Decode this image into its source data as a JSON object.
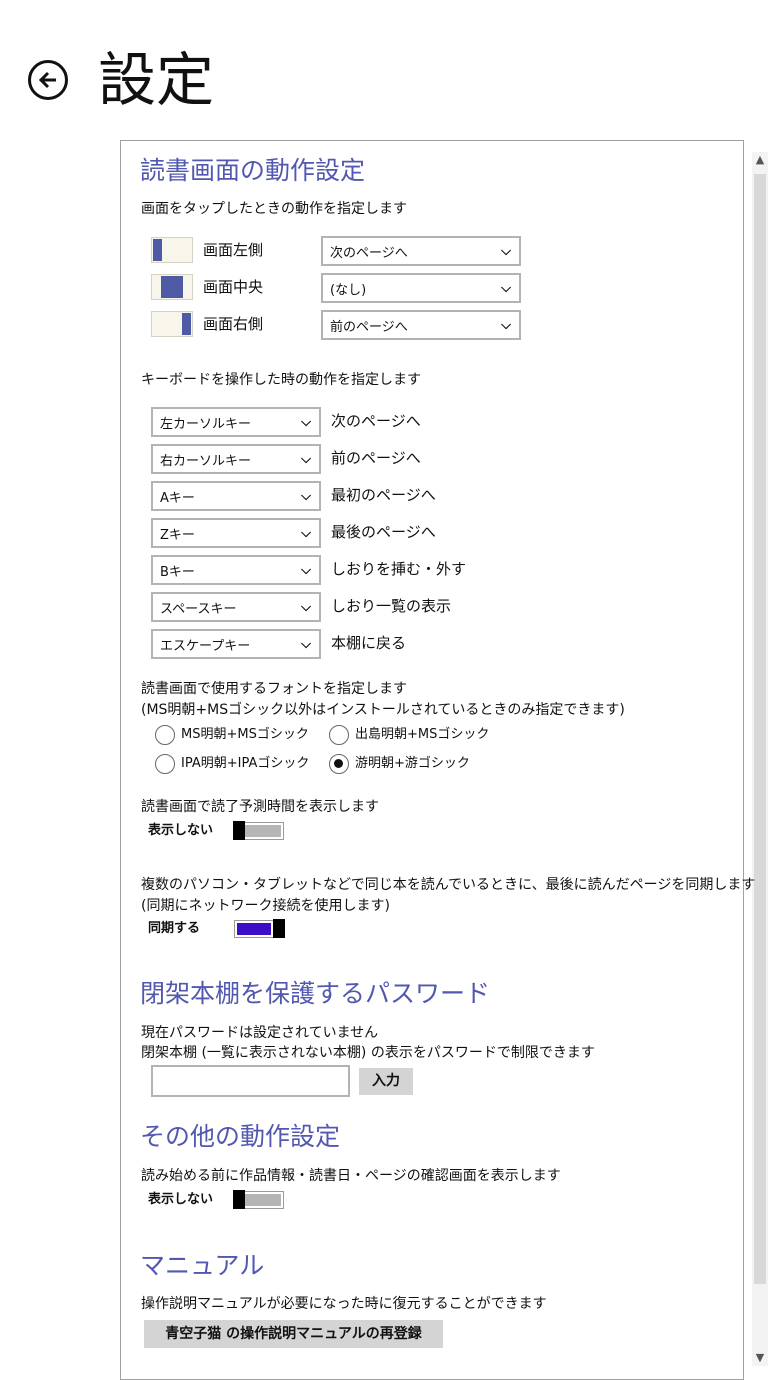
{
  "header": {
    "title": "設定",
    "back_icon": "arrow-left-circle-icon"
  },
  "reading": {
    "heading": "読書画面の動作設定",
    "tap_desc": "画面をタップしたときの動作を指定します",
    "tap_rows": [
      {
        "label": "画面左側",
        "value": "次のページへ"
      },
      {
        "label": "画面中央",
        "value": "(なし)"
      },
      {
        "label": "画面右側",
        "value": "前のページへ"
      }
    ],
    "keyboard_desc": "キーボードを操作した時の動作を指定します",
    "key_rows": [
      {
        "key": "左カーソルキー",
        "action": "次のページへ"
      },
      {
        "key": "右カーソルキー",
        "action": "前のページへ"
      },
      {
        "key": "Aキー",
        "action": "最初のページへ"
      },
      {
        "key": "Zキー",
        "action": "最後のページへ"
      },
      {
        "key": "Bキー",
        "action": "しおりを挿む・外す"
      },
      {
        "key": "スペースキー",
        "action": "しおり一覧の表示"
      },
      {
        "key": "エスケープキー",
        "action": "本棚に戻る"
      }
    ],
    "font_desc_1": "読書画面で使用するフォントを指定します",
    "font_desc_2": "(MS明朝+MSゴシック以外はインストールされているときのみ指定できます)",
    "font_options": [
      {
        "label": "MS明朝+MSゴシック",
        "selected": false
      },
      {
        "label": "出島明朝+MSゴシック",
        "selected": false
      },
      {
        "label": "IPA明朝+IPAゴシック",
        "selected": false
      },
      {
        "label": "游明朝+游ゴシック",
        "selected": true
      }
    ],
    "time_desc": "読書画面で読了予測時間を表示します",
    "time_toggle": {
      "label": "表示しない",
      "on": false
    },
    "sync_desc_1": "複数のパソコン・タブレットなどで同じ本を読んでいるときに、最後に読んだページを同期します",
    "sync_desc_2": "(同期にネットワーク接続を使用します)",
    "sync_toggle": {
      "label": "同期する",
      "on": true
    }
  },
  "password": {
    "heading": "閉架本棚を保護するパスワード",
    "desc_1": "現在パスワードは設定されていません",
    "desc_2": "閉架本棚 (一覧に表示されない本棚) の表示をパスワードで制限できます",
    "input_value": "",
    "button": "入力"
  },
  "other": {
    "heading": "その他の動作設定",
    "desc": "読み始める前に作品情報・読書日・ページの確認画面を表示します",
    "toggle": {
      "label": "表示しない",
      "on": false
    }
  },
  "manual": {
    "heading": "マニュアル",
    "desc": "操作説明マニュアルが必要になった時に復元することができます",
    "button": "青空子猫 の操作説明マニュアルの再登録"
  },
  "colors": {
    "accent": "#5258b0",
    "tap_mark": "#4e5aa4",
    "toggle_on": "#3d0ec7"
  }
}
